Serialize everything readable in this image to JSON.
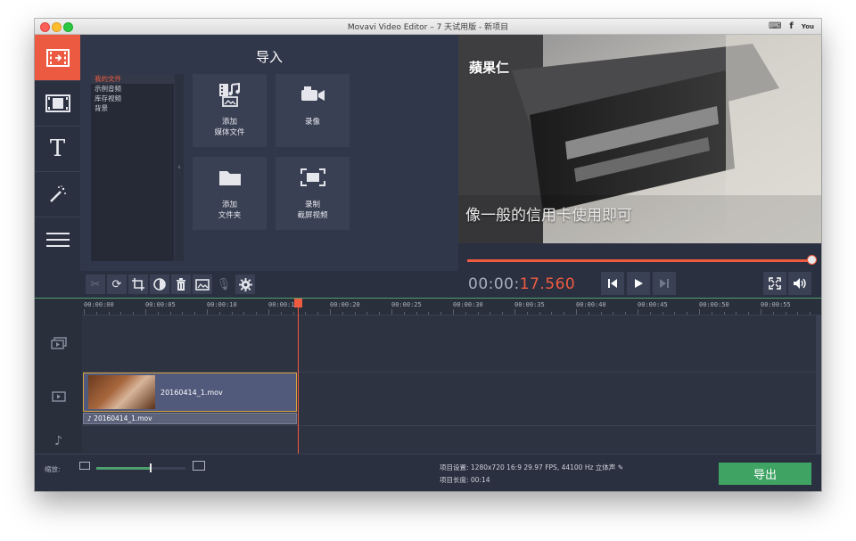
{
  "window": {
    "title": "Movavi Video Editor – 7 天试用版 - 新项目"
  },
  "titlebar_icons": [
    {
      "name": "subtitle-icon",
      "glyph": "⌨"
    },
    {
      "name": "facebook-icon",
      "glyph": "f"
    },
    {
      "name": "youtube-icon",
      "glyph": "You"
    }
  ],
  "sidebar": {
    "tools": [
      {
        "name": "import-tool",
        "icon": "film-import-icon"
      },
      {
        "name": "filters-tool",
        "icon": "film-filter-icon"
      },
      {
        "name": "titles-tool",
        "icon": "text-icon",
        "glyph": "T"
      },
      {
        "name": "effects-tool",
        "icon": "magic-wand-icon"
      },
      {
        "name": "more-tool",
        "icon": "menu-icon"
      }
    ]
  },
  "import_panel": {
    "title": "导入",
    "categories": [
      "我的文件",
      "示例音频",
      "库存视频",
      "背景"
    ],
    "tiles": [
      {
        "label": "添加\n媒体文件",
        "icon": "add-media-icon"
      },
      {
        "label": "录像",
        "icon": "camera-icon"
      },
      {
        "label": "添加\n文件夹",
        "icon": "folder-icon"
      },
      {
        "label": "录制\n截屏视频",
        "icon": "screen-record-icon"
      }
    ]
  },
  "edit_toolbar": {
    "buttons": [
      "cut",
      "rotate",
      "crop",
      "color-adjust",
      "delete",
      "media-props",
      "record-audio",
      "settings"
    ]
  },
  "preview": {
    "watermark": "蘋果仁",
    "subtitle": "像一般的信用卡使用即可",
    "timecode_gray": "00:00:",
    "timecode_red": "17.560",
    "progress_fraction": 0.985
  },
  "timeline": {
    "ticks": [
      "00:00:00",
      "00:00:05",
      "00:00:10",
      "00:00:15",
      "00:00:20",
      "00:00:25",
      "00:00:30",
      "00:00:35",
      "00:00:40",
      "00:00:45",
      "00:00:50",
      "00:00:55"
    ],
    "clip_name": "20160414_1.mov",
    "audio_name": "20160414_1.mov"
  },
  "bottom": {
    "zoom_label": "缩放:",
    "zoom_fraction": 0.6,
    "project_settings": "项目设置:  1280x720 16:9 29.97 FPS, 44100 Hz 立体声",
    "project_length": "项目长度:  00:14",
    "export_label": "导出"
  },
  "colors": {
    "accent": "#ef5b41",
    "export": "#3fa363",
    "panel": "#31374a"
  }
}
